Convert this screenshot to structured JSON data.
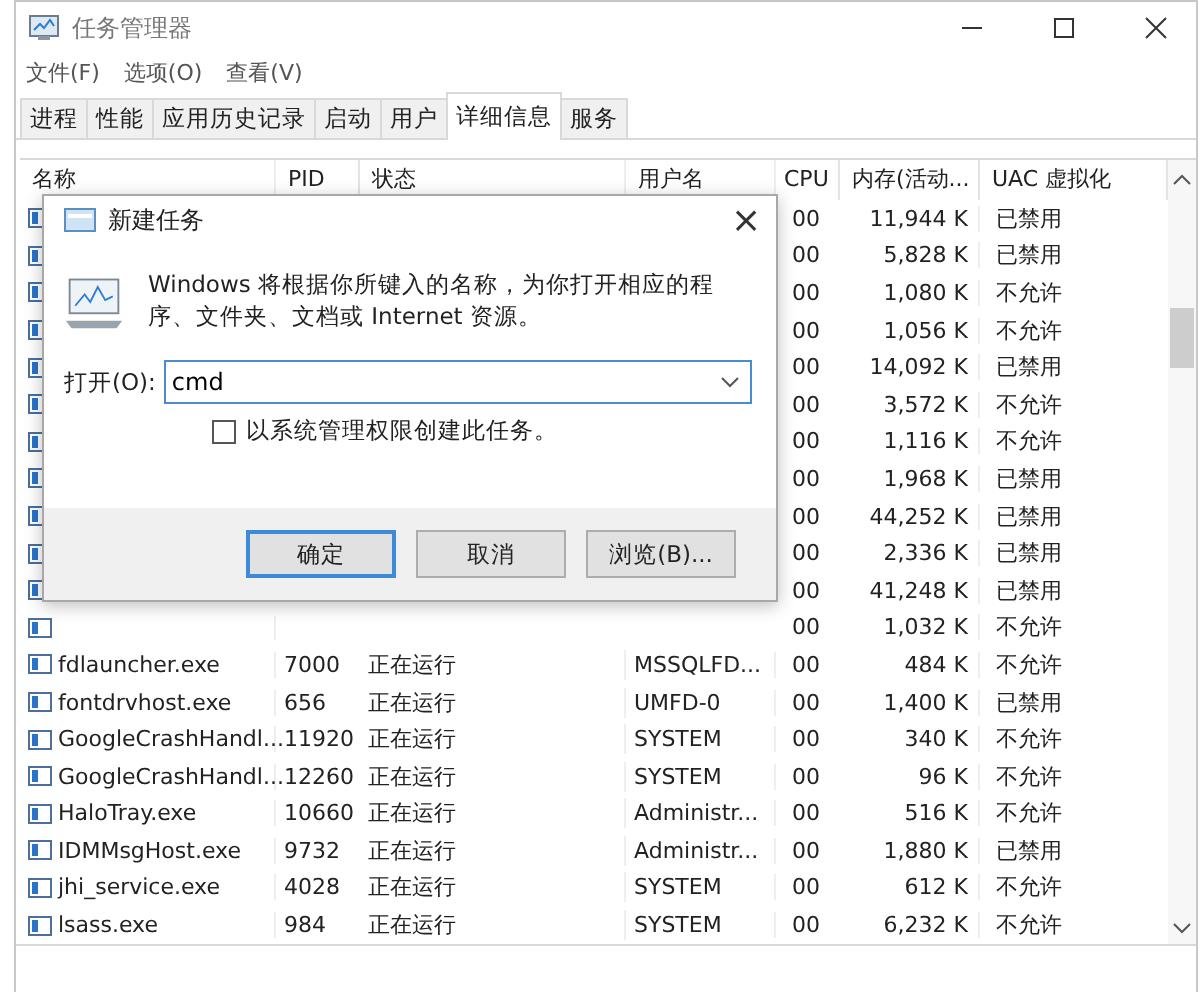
{
  "window": {
    "title": "任务管理器"
  },
  "menu": [
    "文件(F)",
    "选项(O)",
    "查看(V)"
  ],
  "tabs": [
    {
      "label": "进程",
      "selected": false
    },
    {
      "label": "性能",
      "selected": false
    },
    {
      "label": "应用历史记录",
      "selected": false
    },
    {
      "label": "启动",
      "selected": false
    },
    {
      "label": "用户",
      "selected": false
    },
    {
      "label": "详细信息",
      "selected": true
    },
    {
      "label": "服务",
      "selected": false
    }
  ],
  "table": {
    "columns": [
      "名称",
      "PID",
      "状态",
      "用户名",
      "CPU",
      "内存(活动...",
      "UAC 虚拟化"
    ],
    "rows": [
      {
        "cpu": "00",
        "memory": "11,944 K",
        "uac": "已禁用"
      },
      {
        "cpu": "00",
        "memory": "5,828 K",
        "uac": "已禁用"
      },
      {
        "cpu": "00",
        "memory": "1,080 K",
        "uac": "不允许"
      },
      {
        "cpu": "00",
        "memory": "1,056 K",
        "uac": "不允许"
      },
      {
        "cpu": "00",
        "memory": "14,092 K",
        "uac": "已禁用"
      },
      {
        "cpu": "00",
        "memory": "3,572 K",
        "uac": "不允许"
      },
      {
        "cpu": "00",
        "memory": "1,116 K",
        "uac": "不允许"
      },
      {
        "cpu": "00",
        "memory": "1,968 K",
        "uac": "已禁用"
      },
      {
        "cpu": "00",
        "memory": "44,252 K",
        "uac": "已禁用"
      },
      {
        "cpu": "00",
        "memory": "2,336 K",
        "uac": "已禁用"
      },
      {
        "cpu": "00",
        "memory": "41,248 K",
        "uac": "已禁用"
      },
      {
        "cpu": "00",
        "memory": "1,032 K",
        "uac": "不允许"
      },
      {
        "name": "fdlauncher.exe",
        "pid": "7000",
        "status": "正在运行",
        "user": "MSSQLFD...",
        "cpu": "00",
        "memory": "484 K",
        "uac": "不允许"
      },
      {
        "name": "fontdrvhost.exe",
        "pid": "656",
        "status": "正在运行",
        "user": "UMFD-0",
        "cpu": "00",
        "memory": "1,400 K",
        "uac": "已禁用"
      },
      {
        "name": "GoogleCrashHandl...",
        "pid": "11920",
        "status": "正在运行",
        "user": "SYSTEM",
        "cpu": "00",
        "memory": "340 K",
        "uac": "不允许"
      },
      {
        "name": "GoogleCrashHandl...",
        "pid": "12260",
        "status": "正在运行",
        "user": "SYSTEM",
        "cpu": "00",
        "memory": "96 K",
        "uac": "不允许"
      },
      {
        "name": "HaloTray.exe",
        "pid": "10660",
        "status": "正在运行",
        "user": "Administr...",
        "cpu": "00",
        "memory": "516 K",
        "uac": "不允许"
      },
      {
        "name": "IDMMsgHost.exe",
        "pid": "9732",
        "status": "正在运行",
        "user": "Administr...",
        "cpu": "00",
        "memory": "1,880 K",
        "uac": "已禁用"
      },
      {
        "name": "jhi_service.exe",
        "pid": "4028",
        "status": "正在运行",
        "user": "SYSTEM",
        "cpu": "00",
        "memory": "612 K",
        "uac": "不允许"
      },
      {
        "name": "lsass.exe",
        "pid": "984",
        "status": "正在运行",
        "user": "SYSTEM",
        "cpu": "00",
        "memory": "6,232 K",
        "uac": "不允许"
      }
    ]
  },
  "dialog": {
    "title": "新建任务",
    "close": "×",
    "message": "Windows 将根据你所键入的名称，为你打开相应的程序、文件夹、文档或 Internet 资源。",
    "open_label": "打开(O):",
    "open_value": "cmd",
    "admin_checkbox": {
      "label": "以系统管理权限创建此任务。",
      "checked": false
    },
    "buttons": [
      {
        "label": "确定",
        "selected": true
      },
      {
        "label": "取消",
        "selected": false
      },
      {
        "label": "浏览(B)...",
        "selected": false
      }
    ]
  }
}
